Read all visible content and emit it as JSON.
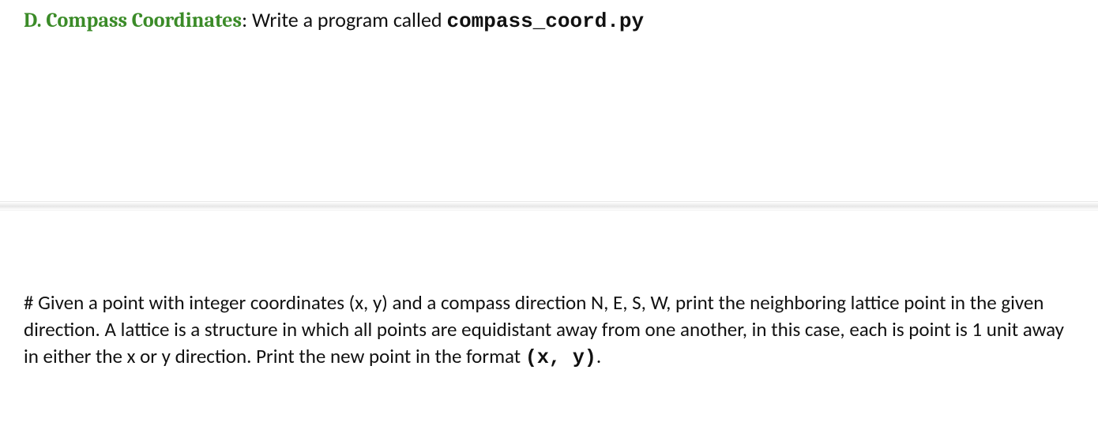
{
  "heading": {
    "prefix": "D. Compass Coordinates",
    "colon": ": ",
    "tail": "Write a program called ",
    "filename": "compass_coord.py"
  },
  "body": {
    "text": "# Given a point with integer coordinates (x, y) and a compass direction N, E, S, W, print the neighboring lattice point in the given direction. A lattice is a structure in which all points are equidistant away from one another, in this case, each is point is 1 unit away in either the x or y direction. Print the new point in the format ",
    "format_code": "(x, y)",
    "period": "."
  }
}
